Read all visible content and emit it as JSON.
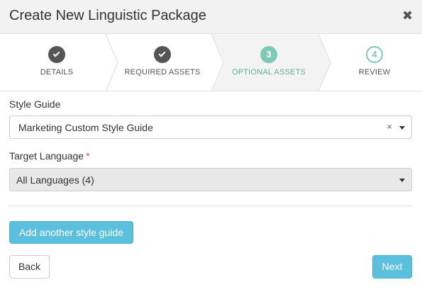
{
  "modal": {
    "title": "Create New Linguistic Package",
    "close_icon": "close-icon"
  },
  "stepper": {
    "steps": [
      {
        "number": "1",
        "label": "DETAILS",
        "state": "completed",
        "icon": "check-icon"
      },
      {
        "number": "2",
        "label": "REQUIRED ASSETS",
        "state": "completed",
        "icon": "check-icon"
      },
      {
        "number": "3",
        "label": "OPTIONAL ASSETS",
        "state": "active"
      },
      {
        "number": "4",
        "label": "REVIEW",
        "state": "upcoming"
      }
    ]
  },
  "form": {
    "style_guide": {
      "label": "Style Guide",
      "value": "Marketing Custom Style Guide",
      "clear_glyph": "×"
    },
    "target_language": {
      "label": "Target Language",
      "required_marker": "*",
      "value": "All Languages (4)"
    }
  },
  "actions": {
    "add_style_guide": "Add another style guide",
    "back": "Back",
    "next": "Next"
  },
  "colors": {
    "accent": "#5bc0de",
    "step_active": "#7ec8b6",
    "step_done": "#555555",
    "required": "#d9534f"
  }
}
